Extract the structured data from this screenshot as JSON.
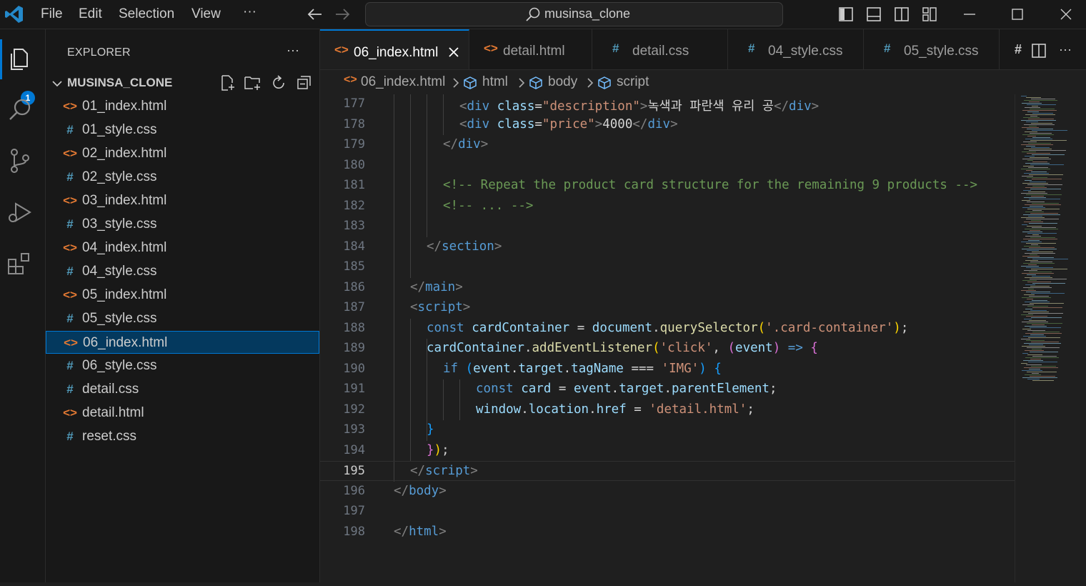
{
  "menu": {
    "file": "File",
    "edit": "Edit",
    "selection": "Selection",
    "view": "View",
    "more": "···"
  },
  "search": {
    "text": "musinsa_clone"
  },
  "activity": {
    "badge": "1"
  },
  "explorer": {
    "title": "EXPLORER",
    "more": "···",
    "project": "MUSINSA_CLONE",
    "files": [
      {
        "name": "01_index.html",
        "type": "html"
      },
      {
        "name": "01_style.css",
        "type": "css"
      },
      {
        "name": "02_index.html",
        "type": "html"
      },
      {
        "name": "02_style.css",
        "type": "css"
      },
      {
        "name": "03_index.html",
        "type": "html"
      },
      {
        "name": "03_style.css",
        "type": "css"
      },
      {
        "name": "04_index.html",
        "type": "html"
      },
      {
        "name": "04_style.css",
        "type": "css"
      },
      {
        "name": "05_index.html",
        "type": "html"
      },
      {
        "name": "05_style.css",
        "type": "css"
      },
      {
        "name": "06_index.html",
        "type": "html"
      },
      {
        "name": "06_style.css",
        "type": "css"
      },
      {
        "name": "detail.css",
        "type": "css"
      },
      {
        "name": "detail.html",
        "type": "html"
      },
      {
        "name": "reset.css",
        "type": "css"
      }
    ],
    "active_file": "06_index.html"
  },
  "tabs": [
    {
      "label": "06_index.html",
      "type": "html",
      "active": true
    },
    {
      "label": "detail.html",
      "type": "html"
    },
    {
      "label": "detail.css",
      "type": "css"
    },
    {
      "label": "04_style.css",
      "type": "css"
    },
    {
      "label": "05_style.css",
      "type": "css"
    }
  ],
  "breadcrumb": [
    "06_index.html",
    "html",
    "body",
    "script"
  ],
  "icons": {
    "html_glyph": "<>",
    "css_glyph": "#"
  },
  "colors": {
    "accent": "#0078d4",
    "html_icon": "#e37933",
    "css_icon": "#519aba",
    "tag": "#569cd6",
    "attr": "#9cdcfe",
    "string": "#ce9178",
    "comment": "#6a9955",
    "keyword": "#569cd6",
    "function": "#dcdcaa",
    "variable": "#9cdcfe",
    "bracket1": "#ffd700",
    "bracket2": "#da70d6",
    "bracket3": "#179fff",
    "text": "#d4d4d4",
    "punct": "#808080"
  },
  "editor": {
    "current_line": 195,
    "lines": [
      {
        "n": "177",
        "indent": 8,
        "tokens": [
          [
            "<",
            "punct"
          ],
          [
            "div",
            "tag"
          ],
          [
            " class",
            "attr"
          ],
          [
            "=",
            "text"
          ],
          [
            "\"description\"",
            "string"
          ],
          [
            ">",
            "punct"
          ],
          [
            "녹색과 파란색 유리 공",
            "text"
          ],
          [
            "</",
            "punct"
          ],
          [
            "div",
            "tag"
          ],
          [
            ">",
            "punct"
          ]
        ]
      },
      {
        "n": "178",
        "indent": 8,
        "tokens": [
          [
            "<",
            "punct"
          ],
          [
            "div",
            "tag"
          ],
          [
            " class",
            "attr"
          ],
          [
            "=",
            "text"
          ],
          [
            "\"price\"",
            "string"
          ],
          [
            ">",
            "punct"
          ],
          [
            "4000",
            "text"
          ],
          [
            "</",
            "punct"
          ],
          [
            "div",
            "tag"
          ],
          [
            ">",
            "punct"
          ]
        ]
      },
      {
        "n": "179",
        "indent": 6,
        "tokens": [
          [
            "</",
            "punct"
          ],
          [
            "div",
            "tag"
          ],
          [
            ">",
            "punct"
          ]
        ]
      },
      {
        "n": "180",
        "indent": 0,
        "tokens": []
      },
      {
        "n": "181",
        "indent": 6,
        "tokens": [
          [
            "<!-- Repeat the product card structure for the remaining 9 products -->",
            "comment"
          ]
        ]
      },
      {
        "n": "182",
        "indent": 6,
        "tokens": [
          [
            "<!-- ... -->",
            "comment"
          ]
        ]
      },
      {
        "n": "183",
        "indent": 0,
        "tokens": []
      },
      {
        "n": "184",
        "indent": 4,
        "tokens": [
          [
            "</",
            "punct"
          ],
          [
            "section",
            "tag"
          ],
          [
            ">",
            "punct"
          ]
        ]
      },
      {
        "n": "185",
        "indent": 0,
        "tokens": []
      },
      {
        "n": "186",
        "indent": 2,
        "tokens": [
          [
            "</",
            "punct"
          ],
          [
            "main",
            "tag"
          ],
          [
            ">",
            "punct"
          ]
        ]
      },
      {
        "n": "187",
        "indent": 2,
        "tokens": [
          [
            "<",
            "punct"
          ],
          [
            "script",
            "tag"
          ],
          [
            ">",
            "punct"
          ]
        ]
      },
      {
        "n": "188",
        "indent": 4,
        "tokens": [
          [
            "const ",
            "keyword"
          ],
          [
            "cardContainer",
            "variable"
          ],
          [
            " = ",
            "text"
          ],
          [
            "document",
            "variable"
          ],
          [
            ".",
            "text"
          ],
          [
            "querySelector",
            "function"
          ],
          [
            "(",
            "bracket1"
          ],
          [
            "'.card-container'",
            "string"
          ],
          [
            ")",
            "bracket1"
          ],
          [
            ";",
            "text"
          ]
        ]
      },
      {
        "n": "189",
        "indent": 4,
        "tokens": [
          [
            "cardContainer",
            "variable"
          ],
          [
            ".",
            "text"
          ],
          [
            "addEventListener",
            "function"
          ],
          [
            "(",
            "bracket1"
          ],
          [
            "'click'",
            "string"
          ],
          [
            ", ",
            "text"
          ],
          [
            "(",
            "bracket2"
          ],
          [
            "event",
            "variable"
          ],
          [
            ")",
            "bracket2"
          ],
          [
            " => ",
            "keyword"
          ],
          [
            "{",
            "bracket2"
          ]
        ]
      },
      {
        "n": "190",
        "indent": 6,
        "tokens": [
          [
            "if ",
            "keyword"
          ],
          [
            "(",
            "bracket3"
          ],
          [
            "event",
            "variable"
          ],
          [
            ".",
            "text"
          ],
          [
            "target",
            "variable"
          ],
          [
            ".",
            "text"
          ],
          [
            "tagName",
            "variable"
          ],
          [
            " === ",
            "text"
          ],
          [
            "'IMG'",
            "string"
          ],
          [
            ")",
            "bracket3"
          ],
          [
            " {",
            "bracket3"
          ]
        ]
      },
      {
        "n": "191",
        "indent": 10,
        "tokens": [
          [
            "const ",
            "keyword"
          ],
          [
            "card",
            "variable"
          ],
          [
            " = ",
            "text"
          ],
          [
            "event",
            "variable"
          ],
          [
            ".",
            "text"
          ],
          [
            "target",
            "variable"
          ],
          [
            ".",
            "text"
          ],
          [
            "parentElement",
            "variable"
          ],
          [
            ";",
            "text"
          ]
        ]
      },
      {
        "n": "192",
        "indent": 10,
        "tokens": [
          [
            "window",
            "variable"
          ],
          [
            ".",
            "text"
          ],
          [
            "location",
            "variable"
          ],
          [
            ".",
            "text"
          ],
          [
            "href",
            "variable"
          ],
          [
            " = ",
            "text"
          ],
          [
            "'detail.html'",
            "string"
          ],
          [
            ";",
            "text"
          ]
        ]
      },
      {
        "n": "193",
        "indent": 4,
        "tokens": [
          [
            "}",
            "bracket3"
          ]
        ]
      },
      {
        "n": "194",
        "indent": 4,
        "tokens": [
          [
            "}",
            "bracket2"
          ],
          [
            ")",
            "bracket1"
          ],
          [
            ";",
            "text"
          ]
        ]
      },
      {
        "n": "195",
        "indent": 2,
        "tokens": [
          [
            "</",
            "punct"
          ],
          [
            "script",
            "tag"
          ],
          [
            ">",
            "punct"
          ]
        ]
      },
      {
        "n": "196",
        "indent": 0,
        "tokens": [
          [
            "</",
            "punct"
          ],
          [
            "body",
            "tag"
          ],
          [
            ">",
            "punct"
          ]
        ]
      },
      {
        "n": "197",
        "indent": 0,
        "tokens": []
      },
      {
        "n": "198",
        "indent": 0,
        "tokens": [
          [
            "</",
            "punct"
          ],
          [
            "html",
            "tag"
          ],
          [
            ">",
            "punct"
          ]
        ]
      }
    ]
  }
}
